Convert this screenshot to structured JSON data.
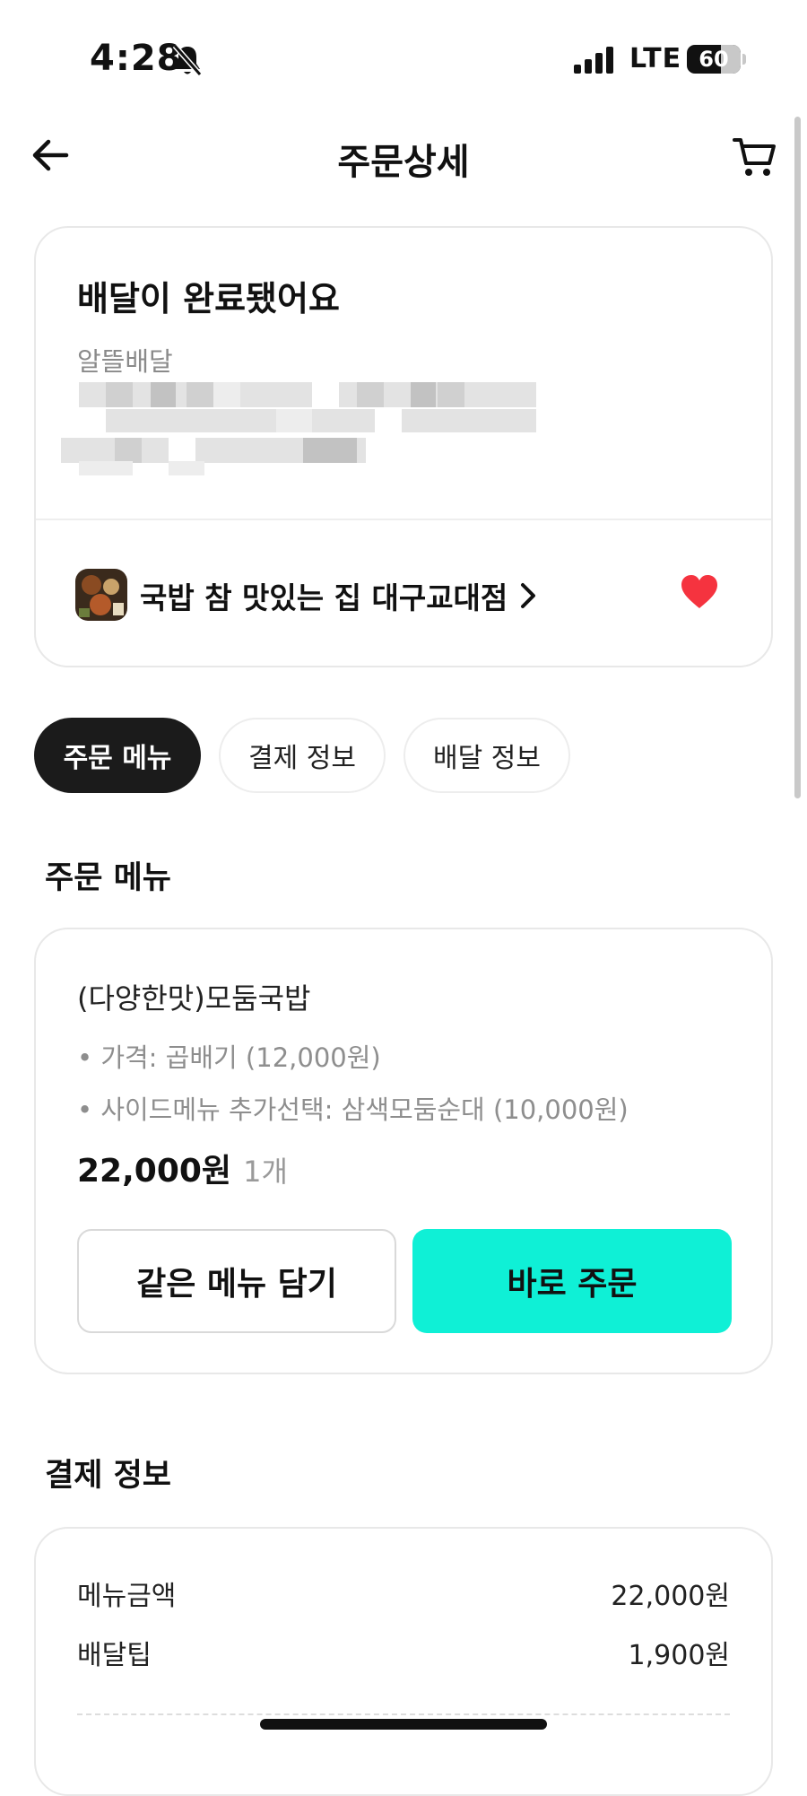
{
  "status_bar": {
    "time": "4:28",
    "network": "LTE",
    "battery": "60",
    "icons": [
      "bell-slash-icon",
      "signal-icon"
    ]
  },
  "header": {
    "title": "주문상세",
    "icons": [
      "back-arrow-icon",
      "cart-icon"
    ]
  },
  "order_status": {
    "title": "배달이 완료됐어요",
    "delivery_type": "알뜰배달",
    "store": {
      "name": "국밥 참 맛있는 집 대구교대점",
      "favorite": true,
      "heart_color": "#f5333f"
    }
  },
  "tabs": [
    {
      "label": "주문 메뉴",
      "active": true
    },
    {
      "label": "결제 정보",
      "active": false
    },
    {
      "label": "배달 정보",
      "active": false
    }
  ],
  "menu_section": {
    "heading": "주문 메뉴",
    "item": {
      "name": "(다양한맛)모둠국밥",
      "options": [
        "• 가격: 곱배기 (12,000원)",
        "• 사이드메뉴 추가선택: 삼색모둠순대 (10,000원)"
      ],
      "price": "22,000원",
      "quantity": "1개"
    },
    "buttons": {
      "add_same": "같은 메뉴 담기",
      "order_now": "바로 주문"
    },
    "accent_color": "#0ff0d6"
  },
  "payment_section": {
    "heading": "결제 정보",
    "rows": [
      {
        "label": "메뉴금액",
        "value": "22,000원"
      },
      {
        "label": "배달팁",
        "value": "1,900원"
      }
    ]
  }
}
